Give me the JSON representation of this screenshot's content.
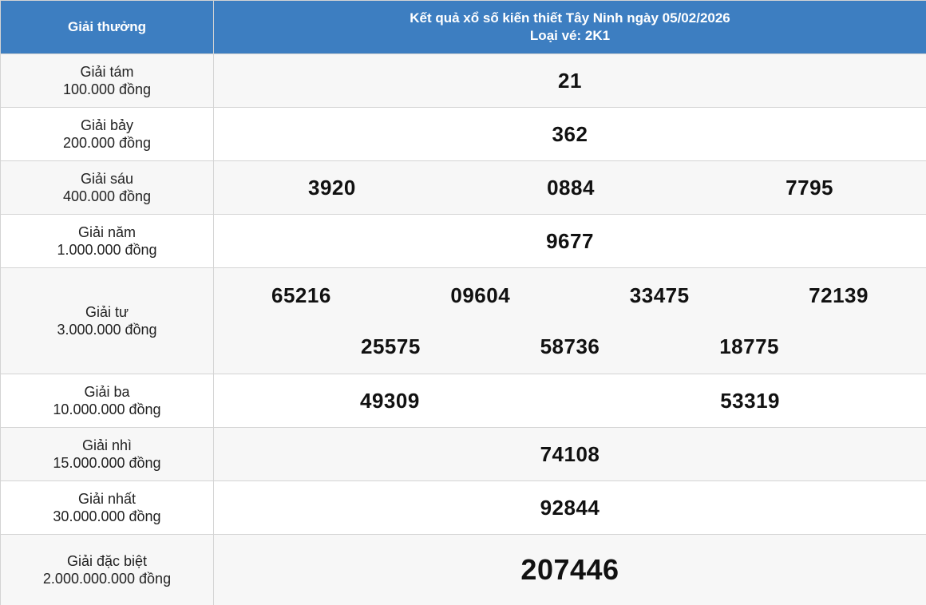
{
  "header": {
    "col_prize": "Giải thưởng",
    "title_line1": "Kết quả xổ số kiến thiết Tây Ninh ngày 05/02/2026",
    "title_line2": "Loại vé: 2K1"
  },
  "prizes": [
    {
      "name": "Giải tám",
      "amount": "100.000 đồng",
      "numbers": [
        "21"
      ]
    },
    {
      "name": "Giải bảy",
      "amount": "200.000 đồng",
      "numbers": [
        "362"
      ]
    },
    {
      "name": "Giải sáu",
      "amount": "400.000 đồng",
      "numbers": [
        "3920",
        "0884",
        "7795"
      ]
    },
    {
      "name": "Giải năm",
      "amount": "1.000.000 đồng",
      "numbers": [
        "9677"
      ]
    },
    {
      "name": "Giải tư",
      "amount": "3.000.000 đồng",
      "numbers": [
        "65216",
        "09604",
        "33475",
        "72139",
        "25575",
        "58736",
        "18775"
      ]
    },
    {
      "name": "Giải ba",
      "amount": "10.000.000 đồng",
      "numbers": [
        "49309",
        "53319"
      ]
    },
    {
      "name": "Giải nhì",
      "amount": "15.000.000 đồng",
      "numbers": [
        "74108"
      ]
    },
    {
      "name": "Giải nhất",
      "amount": "30.000.000 đồng",
      "numbers": [
        "92844"
      ]
    },
    {
      "name": "Giải đặc biệt",
      "amount": "2.000.000.000 đồng",
      "numbers": [
        "207446"
      ]
    }
  ]
}
